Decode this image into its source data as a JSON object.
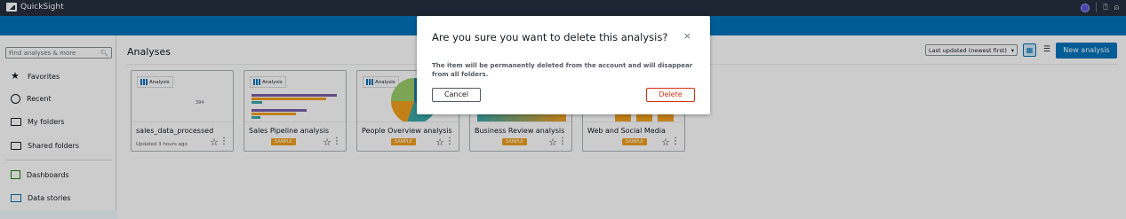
{
  "app": {
    "title": "QuickSight"
  },
  "sidebar": {
    "search_placeholder": "Find analyses & more",
    "items": [
      {
        "label": "Favorites",
        "icon": "star-icon"
      },
      {
        "label": "Recent",
        "icon": "clock-icon"
      },
      {
        "label": "My folders",
        "icon": "folder-icon"
      },
      {
        "label": "Shared folders",
        "icon": "shared-folder-icon"
      },
      {
        "label": "Dashboards",
        "icon": "dashboard-icon"
      },
      {
        "label": "Data stories",
        "icon": "data-stories-icon"
      }
    ]
  },
  "main": {
    "title": "Analyses",
    "sort_label": "Last updated (newest first)",
    "new_button": "New analysis",
    "cards": [
      {
        "name": "sales_data_processed",
        "sub": "Updated 3 hours ago",
        "thumb_label": "Analysis",
        "thumb_value": "394",
        "badge": ""
      },
      {
        "name": "Sales Pipeline analysis",
        "sub": "",
        "thumb_label": "Analysis",
        "badge": "SAMPLE"
      },
      {
        "name": "People Overview analysis",
        "sub": "",
        "thumb_label": "Analysis",
        "badge": "SAMPLE"
      },
      {
        "name": "Business Review analysis",
        "sub": "",
        "thumb_label": "",
        "badge": "SAMPLE"
      },
      {
        "name": "Web and Social Media",
        "sub": "",
        "thumb_label": "",
        "badge": "SAMPLE"
      }
    ]
  },
  "modal": {
    "title": "Are you sure you want to delete this analysis?",
    "close": "×",
    "body": "The item will be permanently deleted from the account and will disappear from all folders.",
    "cancel": "Cancel",
    "delete": "Delete"
  },
  "colors": {
    "topbar": "#232f3e",
    "accent": "#0073bb",
    "danger": "#d13212",
    "sample": "#f2a01e"
  }
}
